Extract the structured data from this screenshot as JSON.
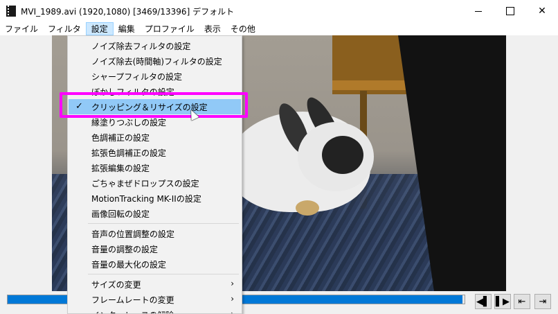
{
  "window": {
    "title": "MVI_1989.avi (1920,1080)  [3469/13396]  デフォルト",
    "close_glyph": "✕"
  },
  "menubar": {
    "items": [
      "ファイル",
      "フィルタ",
      "設定",
      "編集",
      "プロファイル",
      "表示",
      "その他"
    ],
    "active_index": 2
  },
  "dropdown": {
    "items": [
      {
        "label": "ノイズ除去フィルタの設定",
        "checked": false
      },
      {
        "label": "ノイズ除去(時間軸)フィルタの設定",
        "checked": false
      },
      {
        "label": "シャープフィルタの設定",
        "checked": false
      },
      {
        "label": "ぼかしフィルタの設定",
        "checked": false
      },
      {
        "label": "クリッピング＆リサイズの設定",
        "checked": true
      },
      {
        "label": "縁塗りつぶしの設定",
        "checked": false
      },
      {
        "label": "色調補正の設定",
        "checked": false
      },
      {
        "label": "拡張色調補正の設定",
        "checked": false
      },
      {
        "label": "拡張編集の設定",
        "checked": false
      },
      {
        "label": "ごちゃまぜドロップスの設定",
        "checked": false
      },
      {
        "label": "MotionTracking MK-IIの設定",
        "checked": false
      },
      {
        "label": "画像回転の設定",
        "checked": false
      },
      {
        "label": "音声の位置調整の設定",
        "checked": false
      },
      {
        "label": "音量の調整の設定",
        "checked": false
      },
      {
        "label": "音量の最大化の設定",
        "checked": false
      },
      {
        "label": "サイズの変更",
        "checked": false,
        "submenu": true
      },
      {
        "label": "フレームレートの変更",
        "checked": false,
        "submenu": true
      },
      {
        "label": "インターレースの解除",
        "checked": false,
        "submenu": true
      }
    ],
    "check_glyph": "✓",
    "submenu_glyph": "›"
  },
  "playback": {
    "progress_fraction": 0.995,
    "buttons": {
      "prev_frame": "◀▌",
      "next_frame": "▌▶",
      "start": "⇤",
      "end": "⇥"
    }
  },
  "colors": {
    "highlight": "#ff00ff",
    "selected_item": "#91c9f7",
    "seekbar_fill": "#0078d7"
  }
}
